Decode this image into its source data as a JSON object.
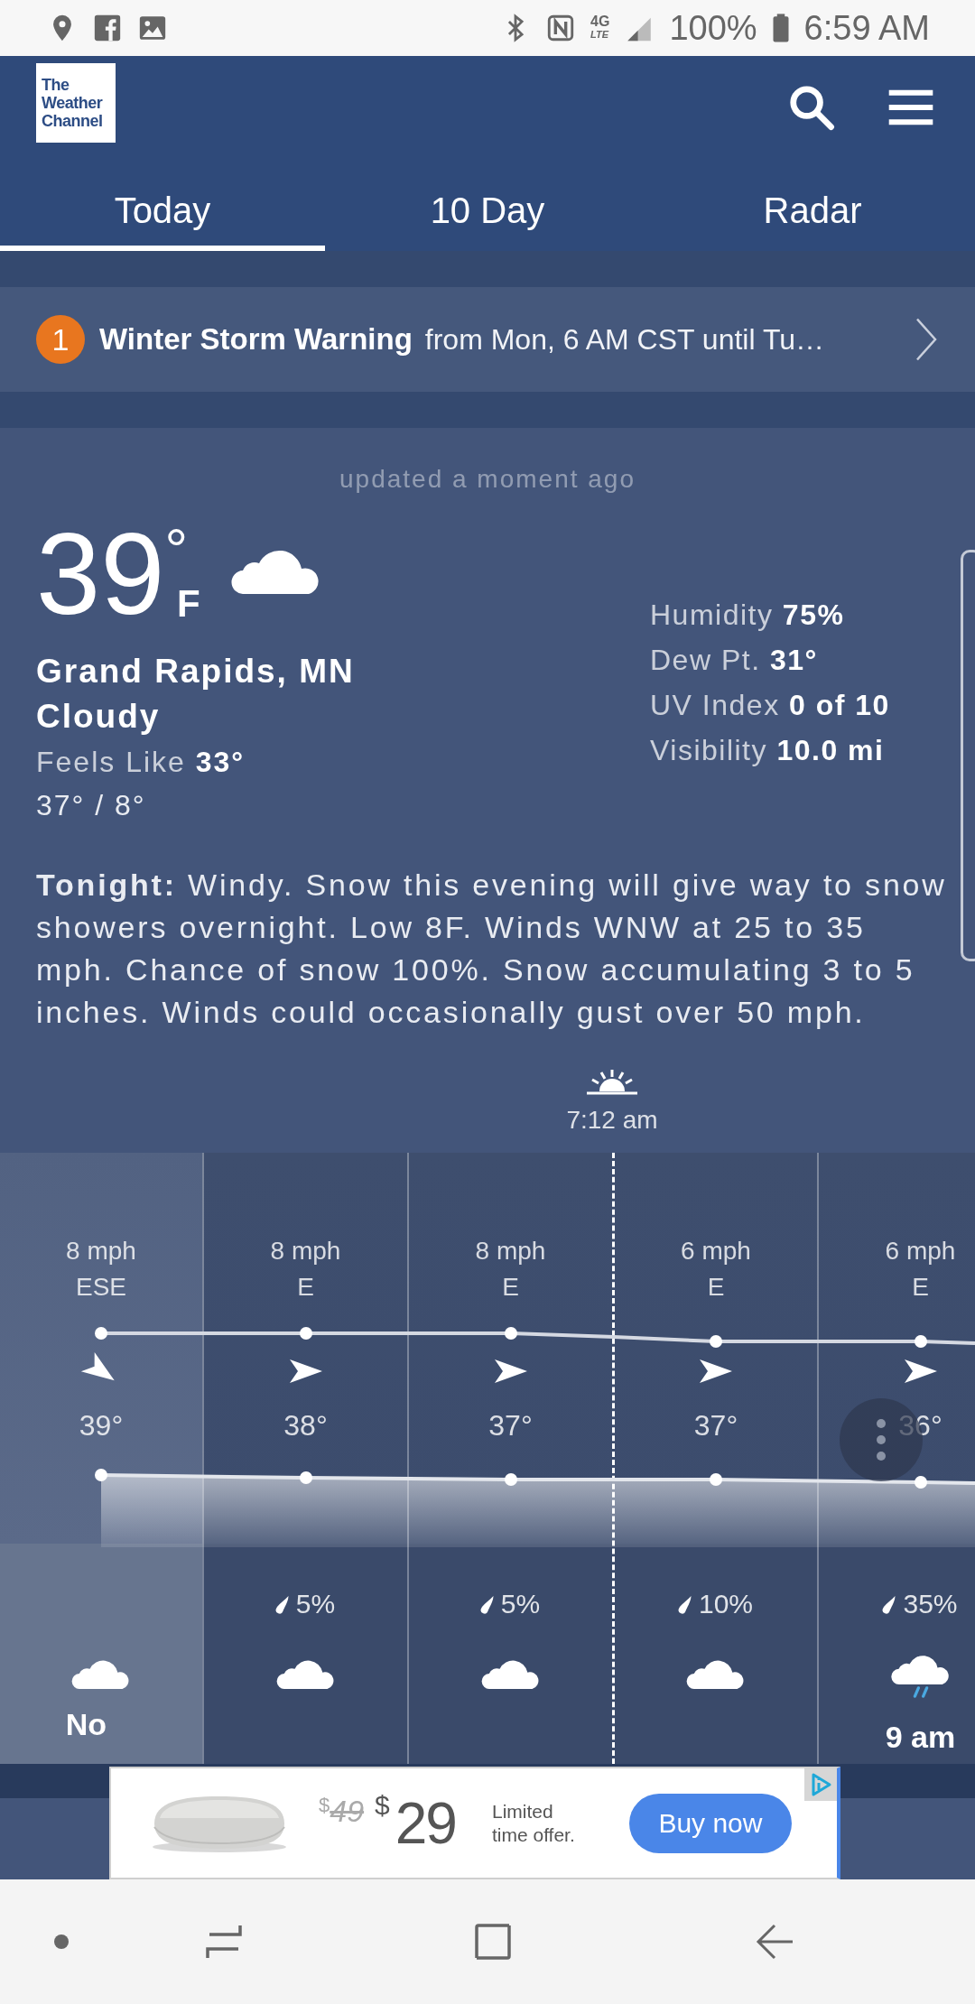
{
  "status_bar": {
    "network": "4G",
    "network_sub": "LTE",
    "battery": "100%",
    "time": "6:59 AM"
  },
  "header": {
    "logo": [
      "The",
      "Weather",
      "Channel"
    ]
  },
  "tabs": [
    {
      "label": "Today",
      "selected": true
    },
    {
      "label": "10 Day",
      "selected": false
    },
    {
      "label": "Radar",
      "selected": false
    }
  ],
  "alert": {
    "count": "1",
    "title": "Winter Storm Warning",
    "detail": "from Mon, 6 AM CST until Tu…"
  },
  "current": {
    "updated": "updated a moment ago",
    "temperature": "39",
    "degree": "°",
    "unit": "F",
    "kind": "cloud",
    "location": "Grand Rapids, MN",
    "condition": "Cloudy",
    "feels_like": {
      "label": "Feels Like",
      "value": "33°"
    },
    "high_low": "37° / 8°",
    "details": [
      {
        "label": "Humidity",
        "value": "75%"
      },
      {
        "label": "Dew Pt.",
        "value": "31°"
      },
      {
        "label": "UV Index",
        "value": "0 of 10"
      },
      {
        "label": "Visibility",
        "value": "10.0 mi"
      }
    ]
  },
  "tonight": "**Tonight:** Windy. Snow this evening will give way to snow showers overnight. Low 8F. Winds WNW at 25 to 35 mph. Chance of snow 100%. Snow accumulating 3 to 5 inches. Winds could occasionally gust over 50 mph.",
  "hourly": {
    "sunrise": {
      "time": "7:12 am"
    },
    "hours": [
      {
        "wind_speed": "8 mph",
        "wind_direction": "ESE",
        "wind_arrow": {
          "kind": "down-right"
        },
        "temperature": "39°",
        "kind": "cloud",
        "time": "No",
        "selected": true,
        "sunrise_before": false
      },
      {
        "wind_speed": "8 mph",
        "wind_direction": "E",
        "wind_arrow": {
          "kind": "right"
        },
        "temperature": "38°",
        "precip": "5%",
        "kind": "cloud",
        "selected": false,
        "sunrise_before": false
      },
      {
        "wind_speed": "8 mph",
        "wind_direction": "E",
        "wind_arrow": {
          "kind": "right"
        },
        "temperature": "37°",
        "precip": "5%",
        "kind": "cloud",
        "selected": false,
        "sunrise_before": false
      },
      {
        "wind_speed": "6 mph",
        "wind_direction": "E",
        "wind_arrow": {
          "kind": "right"
        },
        "temperature": "37°",
        "precip": "10%",
        "kind": "cloud",
        "selected": false,
        "sunrise_before": true
      },
      {
        "wind_speed": "6 mph",
        "wind_direction": "E",
        "wind_arrow": {
          "kind": "right"
        },
        "temperature": "36°",
        "precip": "35%",
        "kind": "rain-cloud",
        "time": "9 am",
        "selected": false,
        "sunrise_before": false
      }
    ]
  },
  "ad": {
    "old_currency": "$",
    "old_price": "49",
    "currency": "$",
    "price": "29",
    "offer": "Limited time offer.",
    "button": "Buy now"
  }
}
